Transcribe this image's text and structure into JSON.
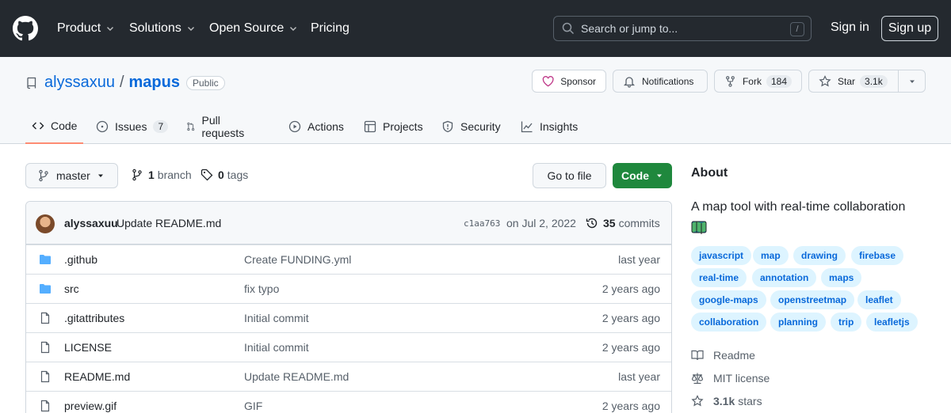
{
  "header": {
    "nav": [
      "Product",
      "Solutions",
      "Open Source",
      "Pricing"
    ],
    "search_placeholder": "Search or jump to...",
    "search_shortcut": "/",
    "signin": "Sign in",
    "signup": "Sign up"
  },
  "repo": {
    "owner": "alyssaxuu",
    "separator": "/",
    "name": "mapus",
    "visibility": "Public",
    "sponsor": "Sponsor",
    "notifications": "Notifications",
    "fork": "Fork",
    "fork_count": "184",
    "star": "Star",
    "star_count": "3.1k"
  },
  "tabs": [
    {
      "label": "Code"
    },
    {
      "label": "Issues",
      "count": "7"
    },
    {
      "label": "Pull requests"
    },
    {
      "label": "Actions"
    },
    {
      "label": "Projects"
    },
    {
      "label": "Security"
    },
    {
      "label": "Insights"
    }
  ],
  "toolbar": {
    "branch": "master",
    "branch_count": "1",
    "branch_label": "branch",
    "tag_count": "0",
    "tag_label": "tags",
    "goto_file": "Go to file",
    "code": "Code"
  },
  "commit": {
    "author": "alyssaxuu",
    "message": "Update README.md",
    "sha": "c1aa763",
    "date": "on Jul 2, 2022",
    "count": "35",
    "count_label": "commits"
  },
  "files": [
    {
      "type": "dir",
      "name": ".github",
      "message": "Create FUNDING.yml",
      "age": "last year"
    },
    {
      "type": "dir",
      "name": "src",
      "message": "fix typo",
      "age": "2 years ago"
    },
    {
      "type": "file",
      "name": ".gitattributes",
      "message": "Initial commit",
      "age": "2 years ago"
    },
    {
      "type": "file",
      "name": "LICENSE",
      "message": "Initial commit",
      "age": "2 years ago"
    },
    {
      "type": "file",
      "name": "README.md",
      "message": "Update README.md",
      "age": "last year"
    },
    {
      "type": "file",
      "name": "preview.gif",
      "message": "GIF",
      "age": "2 years ago"
    }
  ],
  "about": {
    "heading": "About",
    "description": "A map tool with real-time collaboration",
    "topics": [
      "javascript",
      "map",
      "drawing",
      "firebase",
      "real-time",
      "annotation",
      "maps",
      "google-maps",
      "openstreetmap",
      "leaflet",
      "collaboration",
      "planning",
      "trip",
      "leafletjs"
    ],
    "readme": "Readme",
    "license": "MIT license",
    "stars_count": "3.1k",
    "stars_label": "stars"
  },
  "colors": {
    "header_bg": "#24292f",
    "accent": "#0969da",
    "code_button": "#1f883d",
    "tab_underline": "#fd8c73"
  }
}
